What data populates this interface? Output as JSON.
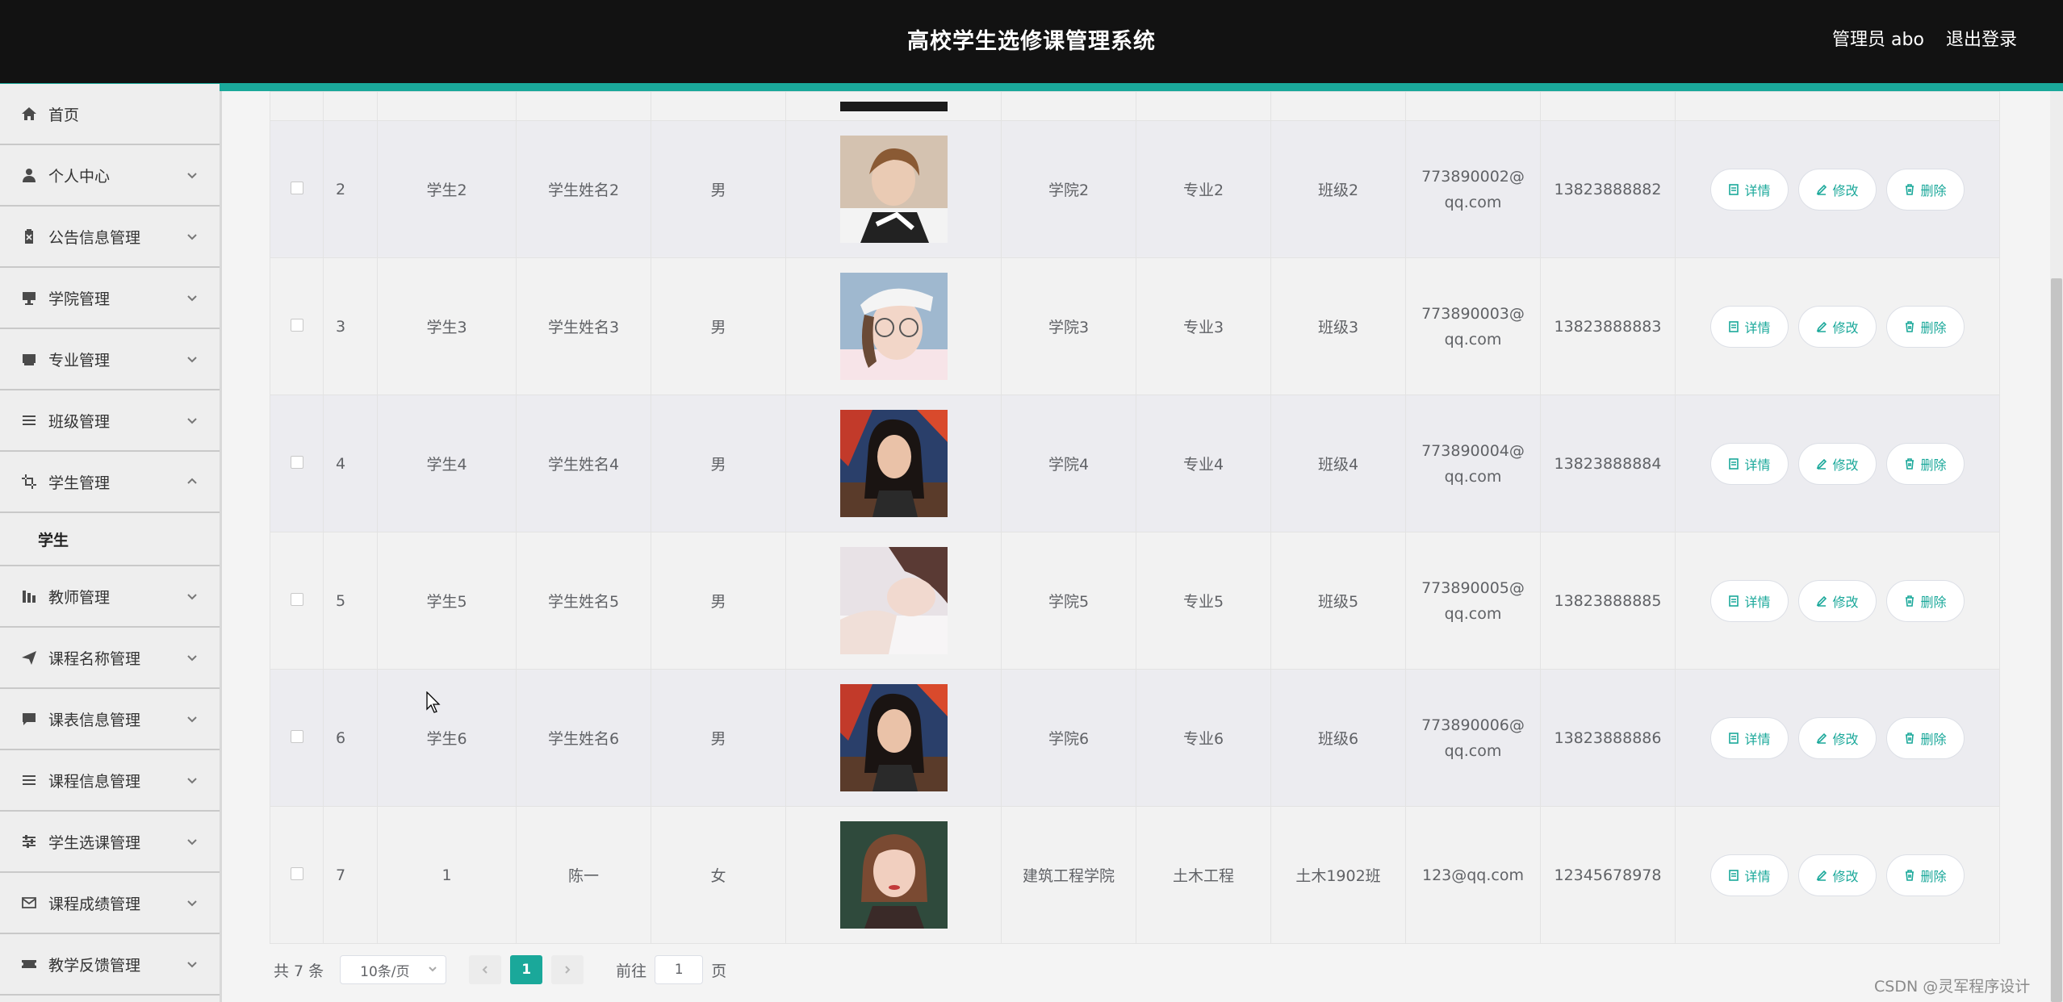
{
  "header": {
    "title": "高校学生选修课管理系统",
    "user": "管理员 abo",
    "logout": "退出登录"
  },
  "sidebar": {
    "items": [
      {
        "label": "首页",
        "icon": "home-icon"
      },
      {
        "label": "个人中心",
        "icon": "user-icon"
      },
      {
        "label": "公告信息管理",
        "icon": "clipboard-icon"
      },
      {
        "label": "学院管理",
        "icon": "monitor-icon"
      },
      {
        "label": "专业管理",
        "icon": "monitor-icon"
      },
      {
        "label": "班级管理",
        "icon": "list-icon"
      },
      {
        "label": "学生管理",
        "icon": "crop-icon"
      },
      {
        "label": "教师管理",
        "icon": "bar-chart-icon"
      },
      {
        "label": "课程名称管理",
        "icon": "send-icon"
      },
      {
        "label": "课表信息管理",
        "icon": "chat-icon"
      },
      {
        "label": "课程信息管理",
        "icon": "menu-icon"
      },
      {
        "label": "学生选课管理",
        "icon": "sliders-icon"
      },
      {
        "label": "课程成绩管理",
        "icon": "mail-icon"
      },
      {
        "label": "教学反馈管理",
        "icon": "ticket-icon"
      }
    ],
    "sub_item": "学生"
  },
  "table": {
    "rows": [
      {
        "index": "2",
        "account": "学生2",
        "name": "学生姓名2",
        "gender": "男",
        "college": "学院2",
        "major": "专业2",
        "class": "班级2",
        "email": "773890002@qq.com",
        "phone": "13823888882"
      },
      {
        "index": "3",
        "account": "学生3",
        "name": "学生姓名3",
        "gender": "男",
        "college": "学院3",
        "major": "专业3",
        "class": "班级3",
        "email": "773890003@qq.com",
        "phone": "13823888883"
      },
      {
        "index": "4",
        "account": "学生4",
        "name": "学生姓名4",
        "gender": "男",
        "college": "学院4",
        "major": "专业4",
        "class": "班级4",
        "email": "773890004@qq.com",
        "phone": "13823888884"
      },
      {
        "index": "5",
        "account": "学生5",
        "name": "学生姓名5",
        "gender": "男",
        "college": "学院5",
        "major": "专业5",
        "class": "班级5",
        "email": "773890005@qq.com",
        "phone": "13823888885"
      },
      {
        "index": "6",
        "account": "学生6",
        "name": "学生姓名6",
        "gender": "男",
        "college": "学院6",
        "major": "专业6",
        "class": "班级6",
        "email": "773890006@qq.com",
        "phone": "13823888886"
      },
      {
        "index": "7",
        "account": "1",
        "name": "陈一",
        "gender": "女",
        "college": "建筑工程学院",
        "major": "土木工程",
        "class": "土木1902班",
        "email": "123@qq.com",
        "phone": "12345678978"
      }
    ],
    "actions": {
      "detail": "详情",
      "edit": "修改",
      "delete": "删除"
    }
  },
  "pagination": {
    "total": "共 7 条",
    "page_size": "10条/页",
    "current_page": "1",
    "goto_label": "前往",
    "goto_value": "1",
    "goto_unit": "页"
  },
  "watermark": "CSDN @灵军程序设计",
  "colors": {
    "accent": "#1aa89a",
    "header_bg": "#121212"
  }
}
